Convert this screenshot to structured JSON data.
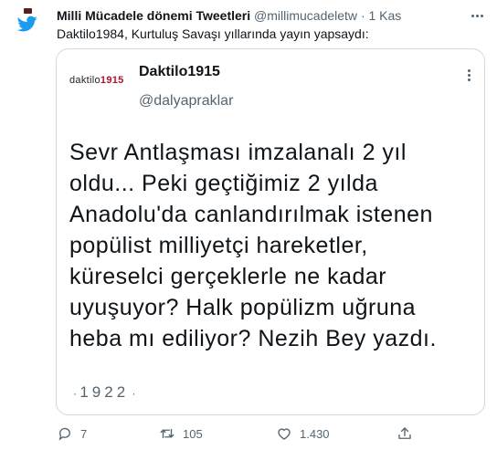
{
  "tweet": {
    "author_name": "Milli Mücadele dönemi Tweetleri",
    "author_handle": "@millimucadeletw",
    "separator": "·",
    "time": "1 Kas",
    "text": "Daktilo1984, Kurtuluş Savaşı yıllarında yayın yapsaydı:"
  },
  "quoted": {
    "logo_word": "daktilo",
    "logo_year": "1915",
    "name": "Daktilo1915",
    "handle": "@dalyapraklar",
    "body": "Sevr Antlaşması imzalanalı 2 yıl\noldu...  Peki geçtiğimiz 2 yılda\nAnadolu'da canlandırılmak istenen\npopülist milliyetçi hareketler,\nküreselci gerçeklerle ne kadar\nuyuşuyor? Halk popülizm uğruna\nheba mı ediliyor? Nezih Bey yazdı.",
    "footer_prefix": "· ",
    "footer_year": "1922",
    "footer_suffix": " ·"
  },
  "actions": {
    "replies": "7",
    "retweets": "105",
    "likes": "1.430"
  },
  "icons": [
    "twitter-bird-icon",
    "more-icon",
    "reply-icon",
    "retweet-icon",
    "like-icon",
    "share-icon"
  ],
  "colors": {
    "brand": "#1d9bf0",
    "muted": "#536471",
    "logo_year": "#b0132e"
  }
}
